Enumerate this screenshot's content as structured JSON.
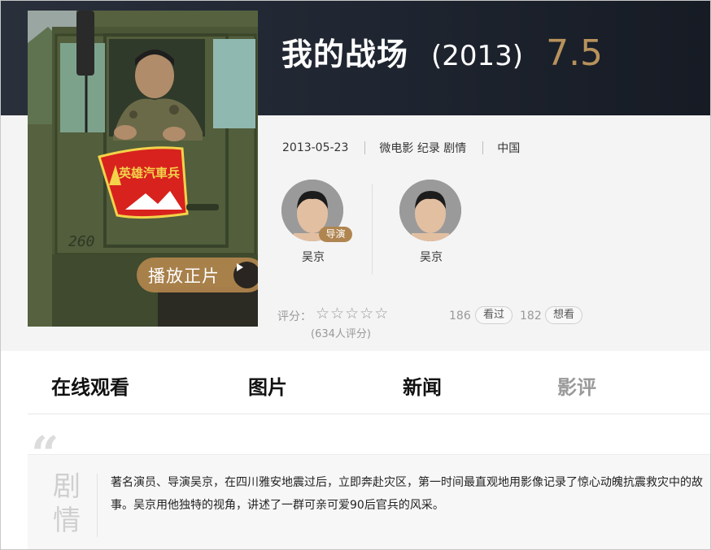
{
  "movie": {
    "title": "我的战场",
    "year": "(2013)",
    "score": "7.5",
    "release_date": "2013-05-23",
    "genres": "微电影 纪录 剧情",
    "region": "中国"
  },
  "poster": {
    "play_label": "播放正片",
    "patch_text": "英雄汽車兵",
    "truck_number": "260"
  },
  "people": [
    {
      "name": "吴京",
      "role": "导演"
    },
    {
      "name": "吴京",
      "role": ""
    }
  ],
  "rating": {
    "label": "评分：",
    "stars_total": 5,
    "count_text": "(634人评分)"
  },
  "actions": {
    "watched_count": "186",
    "watched_label": "看过",
    "want_count": "182",
    "want_label": "想看"
  },
  "tabs": [
    {
      "label": "在线观看",
      "active": true
    },
    {
      "label": "图片",
      "active": true
    },
    {
      "label": "新闻",
      "active": true
    },
    {
      "label": "影评",
      "active": false
    }
  ],
  "plot": {
    "label_line1": "剧",
    "label_line2": "情",
    "text": "著名演员、导演吴京，在四川雅安地震过后，立即奔赴灾区，第一时间最直观地用影像记录了惊心动魄抗震救灾中的故事。吴京用他独特的视角，讲述了一群可亲可爱90后官兵的风采。"
  },
  "colors": {
    "header_bg": "#1f2530",
    "score": "#b8925c",
    "accent_brown": "#b08550"
  }
}
